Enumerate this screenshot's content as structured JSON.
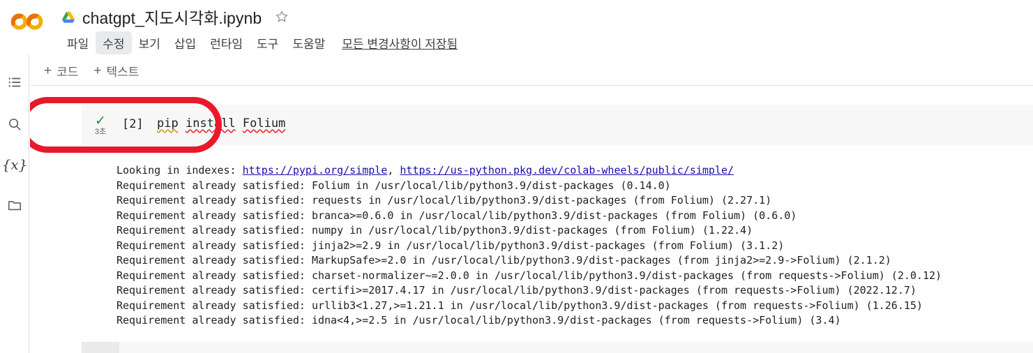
{
  "header": {
    "logo_name": "colab-logo",
    "drive_icon": "google-drive-icon",
    "doc_title": "chatgpt_지도시각화.ipynb",
    "star_icon": "star-outline-icon",
    "menu_items": [
      {
        "label": "파일",
        "active": false
      },
      {
        "label": "수정",
        "active": true
      },
      {
        "label": "보기",
        "active": false
      },
      {
        "label": "삽입",
        "active": false
      },
      {
        "label": "런타임",
        "active": false
      },
      {
        "label": "도구",
        "active": false
      },
      {
        "label": "도움말",
        "active": false
      }
    ],
    "save_status": "모든 변경사항이 저장됨"
  },
  "sidebar": {
    "items": [
      {
        "name": "table-of-contents-icon",
        "label": "목차"
      },
      {
        "name": "search-icon",
        "label": "검색"
      },
      {
        "name": "variables-icon",
        "label": "{x}"
      },
      {
        "name": "files-folder-icon",
        "label": "파일"
      }
    ]
  },
  "toolbar": {
    "add_code_label": "코드",
    "add_text_label": "텍스트",
    "plus": "+"
  },
  "cell": {
    "status_icon": "green-check-icon",
    "exec_time": "3초",
    "exec_count": "[2]",
    "code_tokens": [
      {
        "text": "pip",
        "squiggle": "yellow"
      },
      {
        "text": "install",
        "squiggle": "red"
      },
      {
        "text": "Folium",
        "squiggle": "red"
      }
    ],
    "code_full": "pip install Folium"
  },
  "output": {
    "lines": [
      {
        "parts": [
          {
            "t": "Looking in indexes: ",
            "link": false
          },
          {
            "t": "https://pypi.org/simple",
            "link": true
          },
          {
            "t": ", ",
            "link": false
          },
          {
            "t": "https://us-python.pkg.dev/colab-wheels/public/simple/",
            "link": true
          }
        ]
      },
      {
        "parts": [
          {
            "t": "Requirement already satisfied: Folium in /usr/local/lib/python3.9/dist-packages (0.14.0)",
            "link": false
          }
        ]
      },
      {
        "parts": [
          {
            "t": "Requirement already satisfied: requests in /usr/local/lib/python3.9/dist-packages (from Folium) (2.27.1)",
            "link": false
          }
        ]
      },
      {
        "parts": [
          {
            "t": "Requirement already satisfied: branca>=0.6.0 in /usr/local/lib/python3.9/dist-packages (from Folium) (0.6.0)",
            "link": false
          }
        ]
      },
      {
        "parts": [
          {
            "t": "Requirement already satisfied: numpy in /usr/local/lib/python3.9/dist-packages (from Folium) (1.22.4)",
            "link": false
          }
        ]
      },
      {
        "parts": [
          {
            "t": "Requirement already satisfied: jinja2>=2.9 in /usr/local/lib/python3.9/dist-packages (from Folium) (3.1.2)",
            "link": false
          }
        ]
      },
      {
        "parts": [
          {
            "t": "Requirement already satisfied: MarkupSafe>=2.0 in /usr/local/lib/python3.9/dist-packages (from jinja2>=2.9->Folium) (2.1.2)",
            "link": false
          }
        ]
      },
      {
        "parts": [
          {
            "t": "Requirement already satisfied: charset-normalizer~=2.0.0 in /usr/local/lib/python3.9/dist-packages (from requests->Folium) (2.0.12)",
            "link": false
          }
        ]
      },
      {
        "parts": [
          {
            "t": "Requirement already satisfied: certifi>=2017.4.17 in /usr/local/lib/python3.9/dist-packages (from requests->Folium) (2022.12.7)",
            "link": false
          }
        ]
      },
      {
        "parts": [
          {
            "t": "Requirement already satisfied: urllib3<1.27,>=1.21.1 in /usr/local/lib/python3.9/dist-packages (from requests->Folium) (1.26.15)",
            "link": false
          }
        ]
      },
      {
        "parts": [
          {
            "t": "Requirement already satisfied: idna<4,>=2.5 in /usr/local/lib/python3.9/dist-packages (from requests->Folium) (3.4)",
            "link": false
          }
        ]
      }
    ]
  },
  "annotation": {
    "name": "red-highlight-circle",
    "color": "#e8192c"
  },
  "colors": {
    "accent_orange": "#f9ab00",
    "link_blue": "#1a0dab",
    "check_green": "#1e8e3e",
    "cell_bg": "#f7f7f7",
    "annotation_red": "#e8192c"
  }
}
